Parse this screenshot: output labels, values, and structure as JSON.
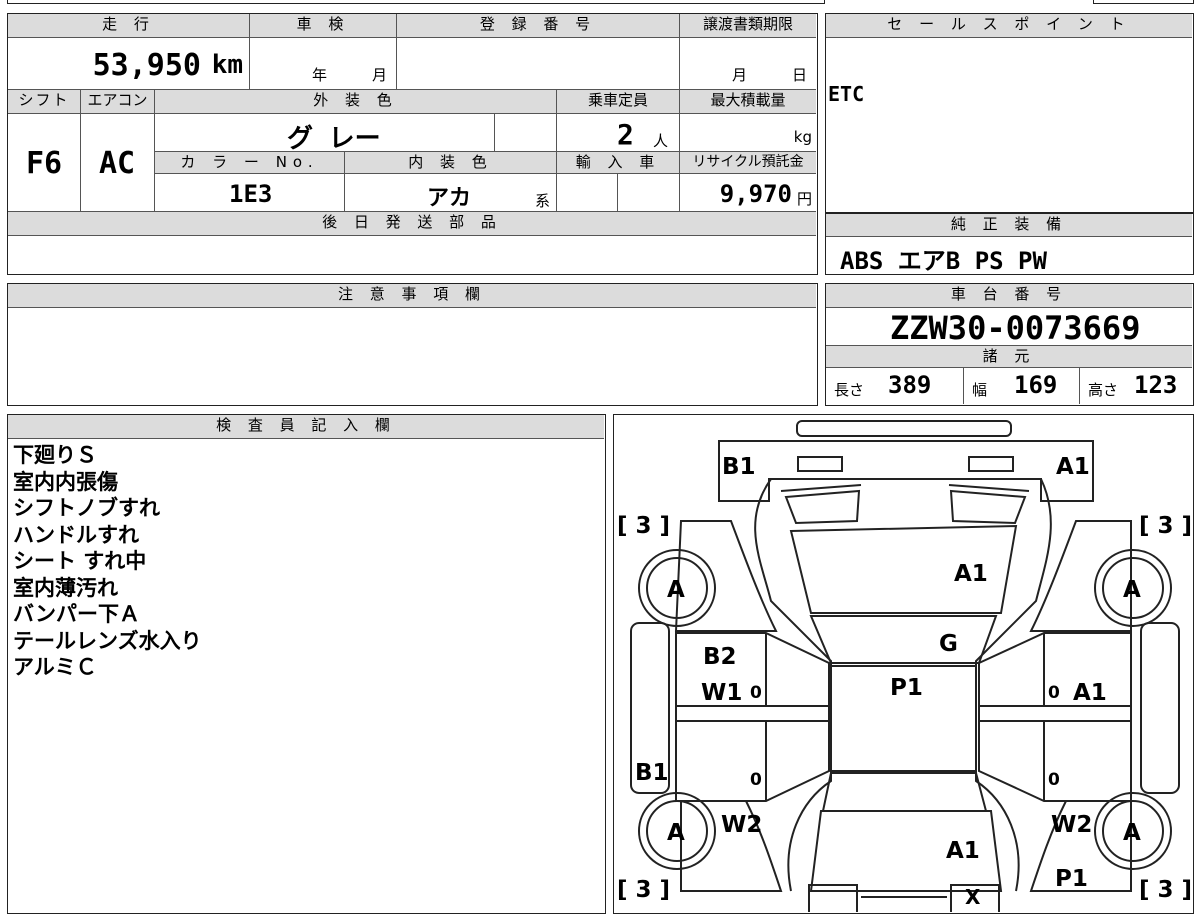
{
  "top_strip": "",
  "sheet": {
    "mileage_label": "走 行",
    "mileage_value": "53,950",
    "mileage_unit": "km",
    "shaken_label": "車 検",
    "shaken_year": "年",
    "shaken_month": "月",
    "reg_label": "登 録 番 号",
    "reg_value": "",
    "transfer_label": "譲渡書類期限",
    "transfer_month": "月",
    "transfer_day": "日",
    "shift_label": "シフト",
    "shift_value": "F6",
    "ac_label": "エアコン",
    "ac_value": "AC",
    "exterior_label": "外 装 色",
    "exterior_value": "グ レー",
    "capacity_label": "乗車定員",
    "capacity_value": "2",
    "capacity_unit": "人",
    "load_label": "最大積載量",
    "load_unit": "kg",
    "color_no_label": "カ ラ ー No.",
    "color_no_value": "1E3",
    "interior_label": "内 装 色",
    "interior_value": "アカ",
    "interior_suffix": "系",
    "import_label": "輸 入 車",
    "recycle_label": "リサイクル預託金",
    "recycle_value": "9,970",
    "recycle_unit": "円",
    "later_parts_label": "後 日 発 送 部 品",
    "later_parts_value": ""
  },
  "sales": {
    "label": "セ ー ル ス ポ イ ン ト",
    "text": "ETC"
  },
  "equipment": {
    "label": "純 正 装 備",
    "text": "ABS エアB PS PW"
  },
  "caution": {
    "label": "注 意 事 項 欄",
    "text": ""
  },
  "chassis": {
    "label": "車 台 番 号",
    "value": "ZZW30-0073669",
    "spec_label": "諸 元",
    "length_label": "長さ",
    "length_value": "389",
    "width_label": "幅",
    "width_value": "169",
    "height_label": "高さ",
    "height_value": "123"
  },
  "inspector": {
    "label": "検 査 員 記 入 欄",
    "notes": [
      "下廻りＳ",
      "室内内張傷",
      "シフトノブすれ",
      "ハンドルすれ",
      "シート すれ中",
      "室内薄汚れ",
      "バンパー下Ａ",
      "テールレンズ水入り",
      "アルミＣ"
    ]
  },
  "diagram": {
    "labels": {
      "front_left": "B1",
      "front_right": "A1",
      "tire_fl": "[ 3 ]",
      "tire_fr": "[ 3 ]",
      "tire_rl": "[ 3 ]",
      "tire_rr": "[ 3 ]",
      "wheel_fl": "A",
      "wheel_fr": "A",
      "wheel_rl": "A",
      "wheel_rr": "A",
      "hood": "A1",
      "windshield": "G",
      "roof": "P1",
      "left_door_upper": "B2",
      "left_door": "W1",
      "right_door": "A1",
      "left_rear": "B1",
      "left_rear_lower": "W2",
      "right_rear_lower": "W2",
      "rear": "A1",
      "rear_right": "P1",
      "rear_bottom": "X",
      "zero_1": "0",
      "zero_2": "0",
      "zero_3": "0",
      "zero_4": "0"
    }
  }
}
